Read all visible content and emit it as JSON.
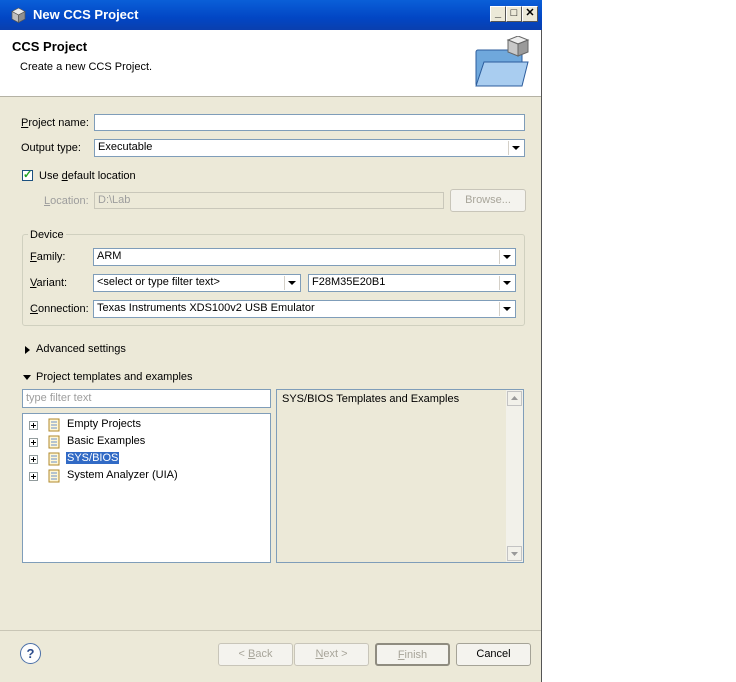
{
  "window": {
    "title": "New CCS Project",
    "controls": {
      "minimize": "_",
      "maximize": "□",
      "close": "✕"
    }
  },
  "header": {
    "title": "CCS Project",
    "description": "Create a new CCS Project.",
    "banner_icon": "folder-with-cube-icon"
  },
  "form": {
    "project_name_label_prefix": "P",
    "project_name_label_rest": "roject name:",
    "project_name_value": "",
    "output_type_label": "Output type:",
    "output_type_value": "Executable",
    "use_default_location_checked": true,
    "use_default_pre": "Use ",
    "use_default_u": "d",
    "use_default_post": "efault location",
    "location_label_u": "L",
    "location_label_rest": "ocation:",
    "location_value": "D:\\Lab",
    "browse_label": "Browse..."
  },
  "device": {
    "group_label": "Device",
    "family_u": "F",
    "family_rest": "amily:",
    "family_value": "ARM",
    "variant_u": "V",
    "variant_rest": "ariant:",
    "variant_filter": "<select or type filter text>",
    "variant_value": "F28M35E20B1",
    "connection_u": "C",
    "connection_rest": "onnection:",
    "connection_value": "Texas Instruments XDS100v2 USB Emulator"
  },
  "advanced_settings": {
    "label": "Advanced settings",
    "expanded": false
  },
  "templates": {
    "label": "Project templates and examples",
    "expanded": true,
    "filter_placeholder": "type filter text",
    "items": [
      {
        "label": "Empty Projects",
        "selected": false
      },
      {
        "label": "Basic Examples",
        "selected": false
      },
      {
        "label": "SYS/BIOS",
        "selected": true
      },
      {
        "label": "System Analyzer (UIA)",
        "selected": false
      }
    ],
    "description": "SYS/BIOS Templates and Examples"
  },
  "footer": {
    "help": "?",
    "back_pre": "< ",
    "back_u": "B",
    "back_rest": "ack",
    "next_u": "N",
    "next_rest": "ext >",
    "finish_u": "F",
    "finish_rest": "inish",
    "cancel": "Cancel"
  }
}
